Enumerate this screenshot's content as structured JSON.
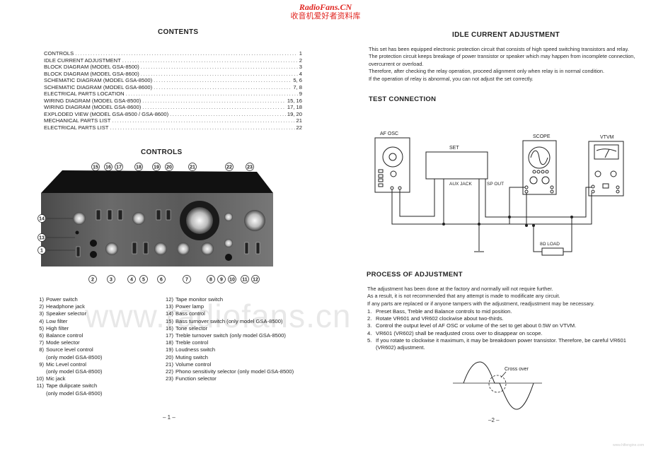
{
  "watermark": {
    "site_en": "RadioFans.CN",
    "site_cn": "收音机爱好者资料库",
    "faint_url": "www.radiofans.cn",
    "footer_url": "www.hifiengine.com"
  },
  "left_page": {
    "contents_title": "CONTENTS",
    "toc": [
      {
        "label": "CONTROLS",
        "page": "1"
      },
      {
        "label": "IDLE CURRENT ADJUSTMENT",
        "page": "2"
      },
      {
        "label": "BLOCK DIAGRAM (MODEL GSA-8500)",
        "page": "3"
      },
      {
        "label": "BLOCK DIAGRAM (MODEL GSA-8600)",
        "page": "4"
      },
      {
        "label": "SCHEMATIC DIAGRAM (MODEL GSA-8500)",
        "page": "5, 6"
      },
      {
        "label": "SCHEMATIC DIAGRAM (MODEL GSA-8600)",
        "page": "7, 8"
      },
      {
        "label": "ELECTRICAL PARTS LOCATION",
        "page": "9"
      },
      {
        "label": "WIRING DIAGRAM (MODEL GSA-8500)",
        "page": "15, 16"
      },
      {
        "label": "WIRING DIAGRAM (MODEL GSA-8600)",
        "page": "17, 18"
      },
      {
        "label": "EXPLODED VIEW (MODEL GSA-8500 / GSA-8600)",
        "page": "19, 20"
      },
      {
        "label": "MECHANICAL PARTS LIST",
        "page": "21"
      },
      {
        "label": "ELECTRICAL PARTS LIST",
        "page": "22"
      }
    ],
    "controls_title": "CONTROLS",
    "figure_callouts": {
      "top": [
        "15",
        "16",
        "17",
        "18",
        "19",
        "20",
        "21",
        "22",
        "23"
      ],
      "left": [
        "14",
        "13",
        "1"
      ],
      "bottom": [
        "2",
        "3",
        "4",
        "5",
        "6",
        "7",
        "8",
        "9",
        "10",
        "11",
        "12"
      ]
    },
    "controls_col1": [
      {
        "n": "1)",
        "label": "Power switch"
      },
      {
        "n": "2)",
        "label": "Headphone jack"
      },
      {
        "n": "3)",
        "label": "Speaker selector"
      },
      {
        "n": "4)",
        "label": "Low filter"
      },
      {
        "n": "5)",
        "label": "High filter"
      },
      {
        "n": "6)",
        "label": "Balance control"
      },
      {
        "n": "7)",
        "label": "Mode selector"
      },
      {
        "n": "8)",
        "label": "Source level control",
        "note": "(only model GSA-8500)"
      },
      {
        "n": "9)",
        "label": "Mic Level control",
        "note": "(only model GSA-8500)"
      },
      {
        "n": "10)",
        "label": "Mic jack"
      },
      {
        "n": "11)",
        "label": "Tape dulipcate switch",
        "note": "(only model GSA-8500)"
      }
    ],
    "controls_col2": [
      {
        "n": "12)",
        "label": "Tape monitor switch"
      },
      {
        "n": "13)",
        "label": "Power lamp"
      },
      {
        "n": "14)",
        "label": "Bass control"
      },
      {
        "n": "15)",
        "label": "Bass turnover switch (only model GSA-8500)"
      },
      {
        "n": "16)",
        "label": "Tone selector"
      },
      {
        "n": "17)",
        "label": "Treble turnover switch (only model GSA-8500)"
      },
      {
        "n": "18)",
        "label": "Treble control"
      },
      {
        "n": "19)",
        "label": "Loudness switch"
      },
      {
        "n": "20)",
        "label": "Muting switch"
      },
      {
        "n": "21)",
        "label": "Volume control"
      },
      {
        "n": "22)",
        "label": "Phono sensitivity selector (only model GSA-8500)"
      },
      {
        "n": "23)",
        "label": "Function selector"
      }
    ],
    "page_number": "– 1 –"
  },
  "right_page": {
    "idle_title": "IDLE CURRENT ADJUSTMENT",
    "idle_paragraphs": [
      "This set has been equipped electronic protection circuit that consists of high speed switching transistors and relay.",
      "The protection circuit keeps breakage of power transistor or speaker which may happen from incomplete connection, overcurrent or overload.",
      "Therefore, after checking the relay operation, proceed alignment only when relay is in normal condition.",
      "If the operation of relay is abnormal, you can not adjust the set correctly."
    ],
    "test_title": "TEST CONNECTION",
    "diagram": {
      "af_osc": "AF OSC",
      "set": "SET",
      "aux_jack": "AUX JACK",
      "sp_out": "SP OUT",
      "scope": "SCOPE",
      "vtvm": "VTVM",
      "load": "8Ω LOAD"
    },
    "process_title": "PROCESS OF ADJUSTMENT",
    "process_intro": [
      "The adjustment has been done at the factory and normally will not require further.",
      "As a result, it is not recommended that any attempt is made to modificate any circuit.",
      "If any parts are replaced or if anyone tampers with the adjustment, readjustment may be necessary."
    ],
    "steps": [
      {
        "n": "1.",
        "text": "Preset Bass, Treble and Balance controls to mid position."
      },
      {
        "n": "2.",
        "text": "Rotate VR601 and VR602 clockwise about two-thirds."
      },
      {
        "n": "3.",
        "text": "Control the output level of AF OSC or volume of the set to get about 0.5W on VTVM."
      },
      {
        "n": "4.",
        "text": "VR601 (VR602) shall be readjusted cross over to disappear on scope."
      },
      {
        "n": "5.",
        "text": "If you rotate to clockwise it maximum, it may be breakdown power transistor. Therefore, be careful VR601 (VR602) adjustment."
      }
    ],
    "crossover_label": "Cross over",
    "page_number": "–2 –"
  }
}
